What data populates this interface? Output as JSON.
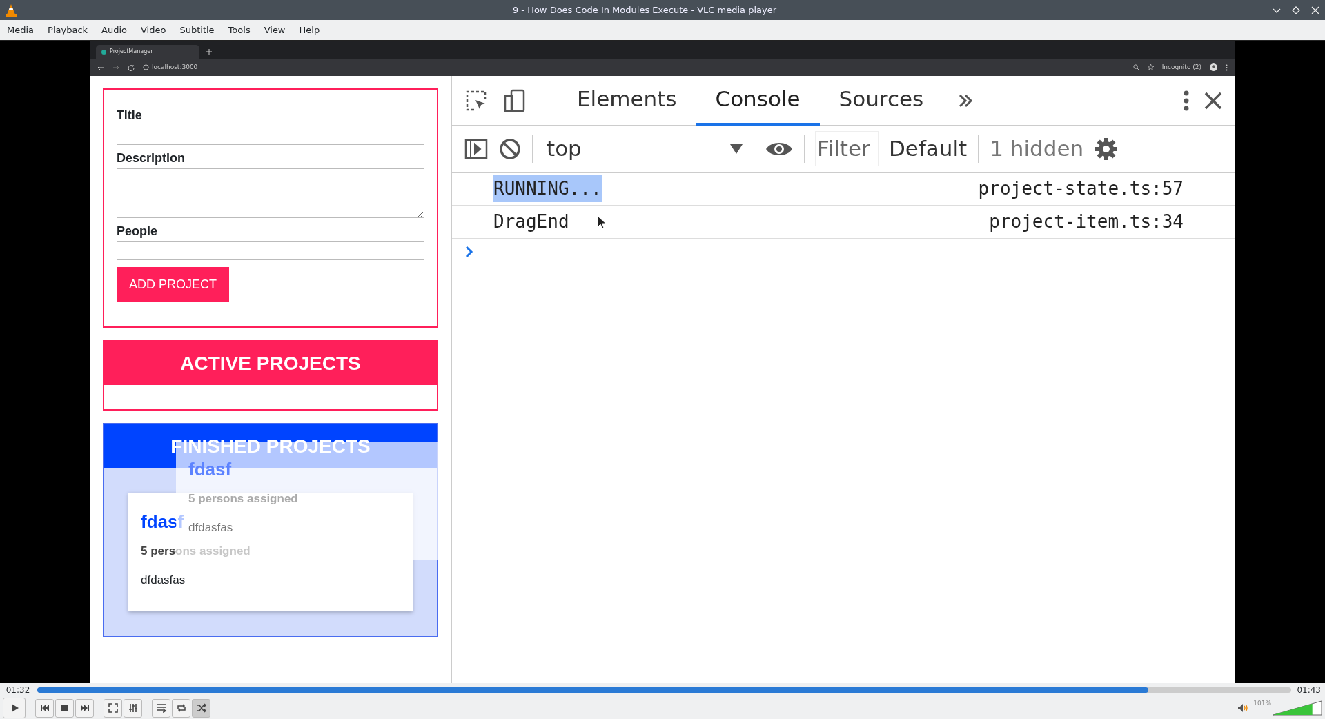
{
  "window": {
    "title": "9 - How Does Code In Modules Execute - VLC media player"
  },
  "menu": [
    "Media",
    "Playback",
    "Audio",
    "Video",
    "Subtitle",
    "Tools",
    "View",
    "Help"
  ],
  "video": {
    "browser": {
      "tabs": [
        {
          "label": "ProjectManager",
          "selected": true
        }
      ],
      "address": "localhost:3000",
      "profile": "Incognito (2)"
    },
    "form": {
      "fields": [
        {
          "label": "Title",
          "kind": "input"
        },
        {
          "label": "Description",
          "kind": "textarea"
        },
        {
          "label": "People",
          "kind": "input"
        }
      ],
      "submit": "ADD PROJECT"
    },
    "active_projects": {
      "title": "ACTIVE PROJECTS"
    },
    "finished_projects": {
      "title": "FINISHED PROJECTS",
      "items": [
        {
          "title": "fdasf",
          "people": "5 persons assigned",
          "description": "dfdasfas"
        }
      ]
    },
    "drag_ghost": {
      "title": "fdasf",
      "people": "5 persons assigned",
      "description": "dfdasfas"
    },
    "devtools": {
      "tabs": [
        {
          "label": "Elements",
          "selected": false
        },
        {
          "label": "Console",
          "selected": true
        },
        {
          "label": "Sources",
          "selected": false
        }
      ],
      "context": "top",
      "filter": {
        "placeholder": "Filter"
      },
      "levels": "Default",
      "hidden": "1 hidden",
      "messages": [
        {
          "text": "RUNNING...",
          "source": "project-state.ts:57",
          "highlighted": true
        },
        {
          "text": "DragEnd",
          "source": "project-item.ts:34",
          "highlighted": false
        }
      ]
    }
  },
  "player": {
    "elapsed": "01:32",
    "total": "01:43",
    "progress": {
      "level": 0.886
    },
    "buttons": [
      {
        "kind": "play",
        "on": false
      },
      {
        "kind": "previous",
        "on": false
      },
      {
        "kind": "stop",
        "on": false
      },
      {
        "kind": "next",
        "on": false
      },
      {
        "kind": "fullscreen",
        "on": false
      },
      {
        "kind": "extended",
        "on": false
      },
      {
        "kind": "playlist",
        "on": false
      },
      {
        "kind": "loop",
        "on": false
      },
      {
        "kind": "shuffle",
        "on": true
      }
    ],
    "volume": {
      "level": 0.81,
      "reading": "101%"
    }
  }
}
